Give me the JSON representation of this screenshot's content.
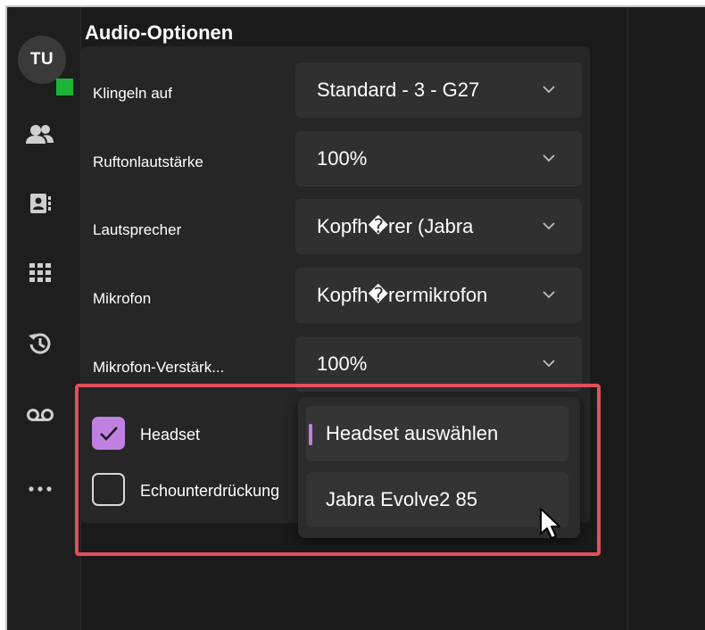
{
  "sidebar": {
    "avatar_initials": "TU",
    "presence_color": "#1fb33a",
    "icons": [
      "people-icon",
      "contacts-icon",
      "dialpad-icon",
      "history-icon",
      "voicemail-icon",
      "more-icon"
    ]
  },
  "section": {
    "title": "Audio-Optionen"
  },
  "rows": [
    {
      "label": "Klingeln auf",
      "value": "Standard - 3 - G27"
    },
    {
      "label": "Ruftonlautstärke",
      "value": "100%"
    },
    {
      "label": "Lautsprecher",
      "value": "Kopfh�rer (Jabra"
    },
    {
      "label": "Mikrofon",
      "value": "Kopfh�rermikrofon"
    },
    {
      "label": "Mikrofon-Verstärk...",
      "value": "100%"
    }
  ],
  "checkboxes": [
    {
      "label": "Headset",
      "checked": true
    },
    {
      "label": "Echounterdrückung",
      "checked": false
    }
  ],
  "headset_dropdown": {
    "options": [
      "Headset auswählen",
      "Jabra Evolve2 85"
    ],
    "selected_index": 0
  },
  "colors": {
    "accent": "#c080e0",
    "highlight_border": "#e2505a",
    "background": "#1a1a1a",
    "panel": "#262626"
  }
}
